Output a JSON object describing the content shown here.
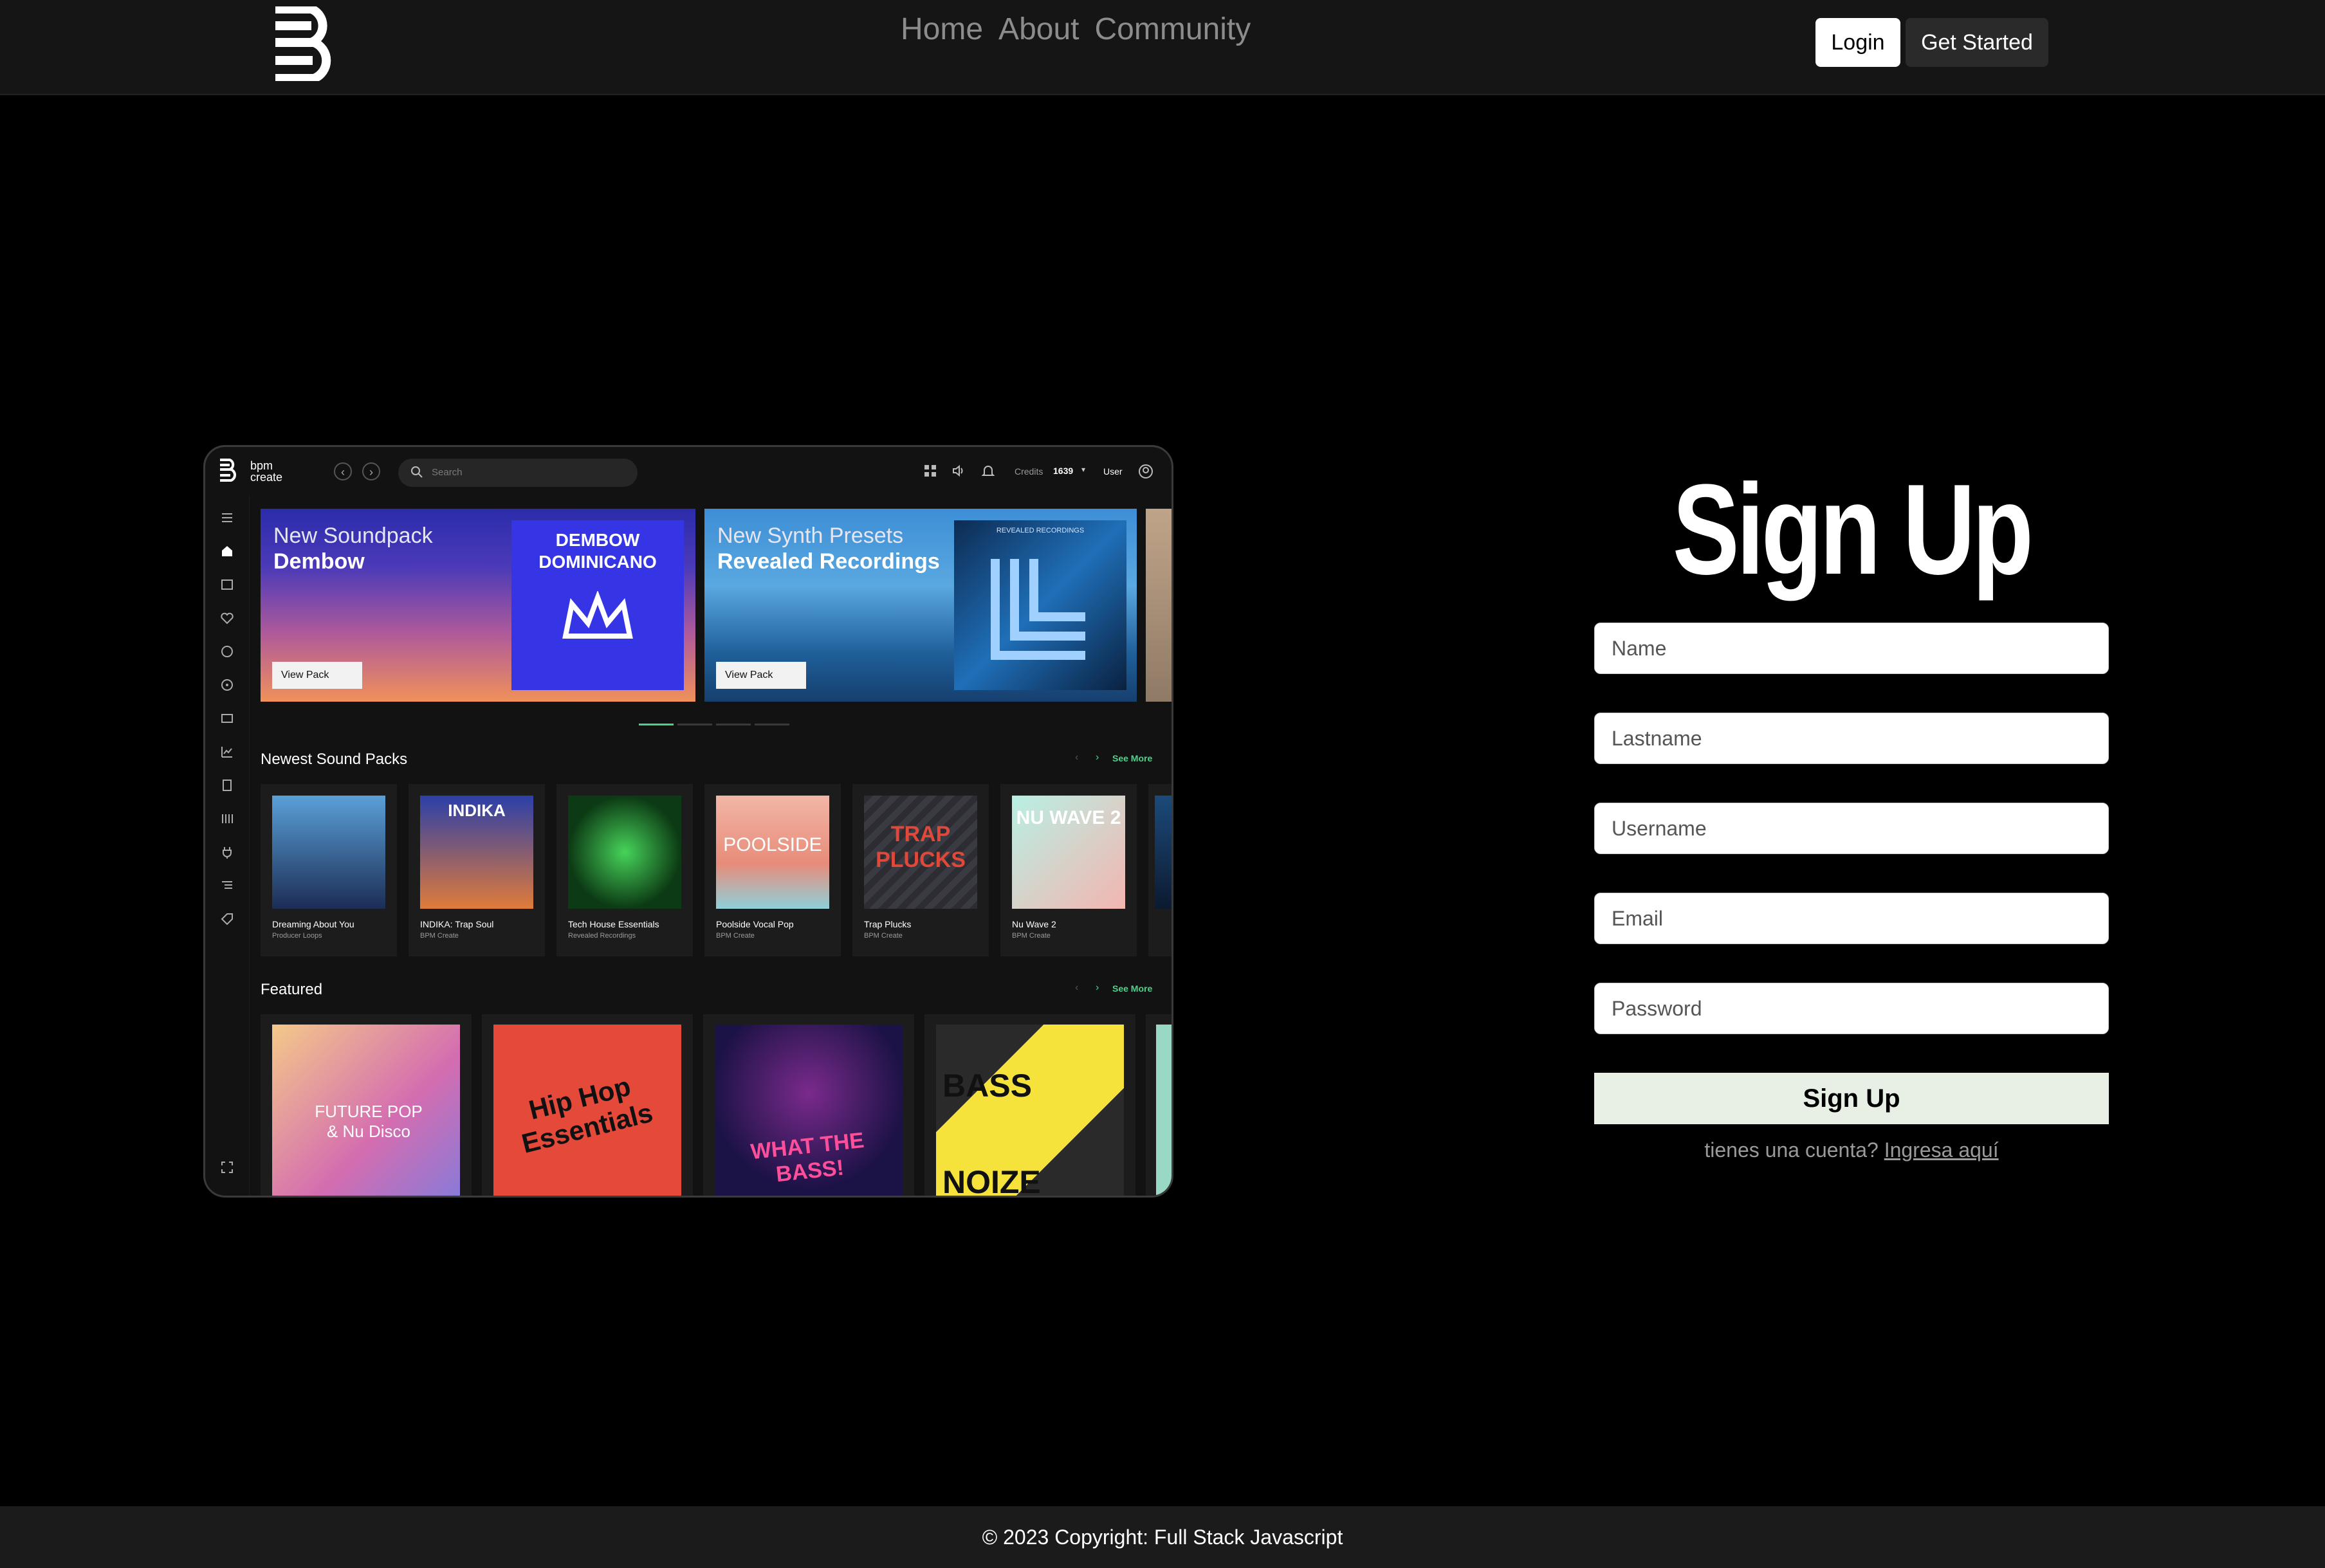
{
  "nav": {
    "links": [
      "Home",
      "About",
      "Community"
    ],
    "login_label": "Login",
    "get_started_label": "Get Started"
  },
  "preview": {
    "brand_line1": "bpm",
    "brand_line2": "create",
    "search_placeholder": "Search",
    "credits_label": "Credits",
    "credits_value": "1639",
    "user_label": "User",
    "banners": [
      {
        "line1": "New Soundpack",
        "line2": "Dembow",
        "button": "View Pack",
        "art_text": "DEMBOW DOMINICANO"
      },
      {
        "line1": "New Synth Presets",
        "line2": "Revealed Recordings",
        "button": "View Pack",
        "art_text": "REVEALED RECORDINGS"
      }
    ],
    "sections": {
      "newest_title": "Newest Sound Packs",
      "featured_title": "Featured",
      "see_more": "See More"
    },
    "newest_packs": [
      {
        "title": "Dreaming About You",
        "label": "Producer Loops",
        "color1": "#5aa0d8",
        "color2": "#1c2d55"
      },
      {
        "title": "INDIKA: Trap Soul",
        "label": "BPM Create",
        "color1": "#2b3fa8",
        "color2": "#e07b3a",
        "art_text": "INDIKA"
      },
      {
        "title": "Tech House Essentials",
        "label": "Revealed Recordings",
        "color1": "#0c3a14",
        "color2": "#47d35a"
      },
      {
        "title": "Poolside Vocal Pop",
        "label": "BPM Create",
        "color1": "#f2b6a6",
        "color2": "#e88c7a",
        "art_text": "POOLSIDE"
      },
      {
        "title": "Trap Plucks",
        "label": "BPM Create",
        "color1": "#2c2c32",
        "color2": "#55555e",
        "art_text": "TRAP PLUCKS"
      },
      {
        "title": "Nu Wave 2",
        "label": "BPM Create",
        "color1": "#b8f0e4",
        "color2": "#f3b5b0",
        "art_text": "NU WAVE 2"
      }
    ],
    "featured_packs": [
      {
        "art_text": "FUTURE POP & Nu Disco",
        "color1": "#f4c98a",
        "color2": "#d46db0"
      },
      {
        "art_text": "Hip Hop Essentials",
        "color1": "#e5493a",
        "color2": "#d83a2e"
      },
      {
        "art_text": "WHAT THE BASS!",
        "color1": "#1b1245",
        "color2": "#7a2a8c"
      },
      {
        "art_text": "BASS NOIZE",
        "color1": "#f5e23a",
        "color2": "#2a2a2a"
      }
    ]
  },
  "signup": {
    "title": "Sign Up",
    "fields": [
      {
        "placeholder": "Name"
      },
      {
        "placeholder": "Lastname"
      },
      {
        "placeholder": "Username"
      },
      {
        "placeholder": "Email"
      },
      {
        "placeholder": "Password"
      }
    ],
    "button_label": "Sign Up",
    "hint_text": "tienes una cuenta?",
    "hint_link": "Ingresa aquí"
  },
  "footer": {
    "text": "© 2023 Copyright: Full Stack Javascript"
  },
  "colors": {
    "background": "#000000",
    "navbar": "#151515",
    "accent_green": "#4bd38a",
    "signup_button": "#e8f0e6"
  }
}
